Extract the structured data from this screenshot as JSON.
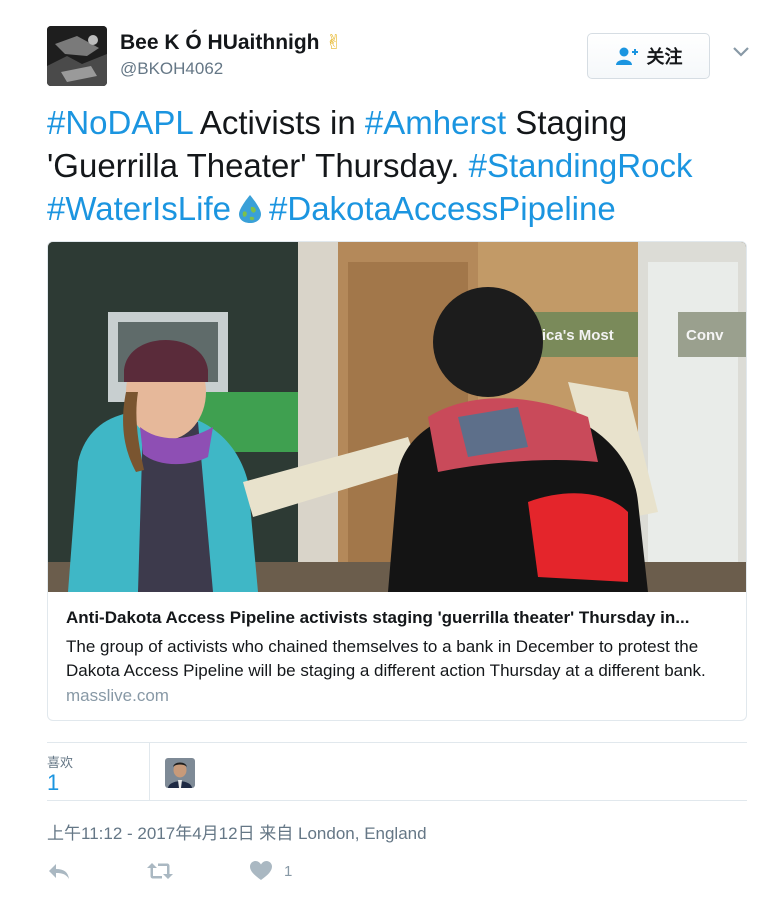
{
  "user": {
    "display_name": "Bee K Ó HUaithnigh",
    "emoji": "✌",
    "handle": "@BKOH4062"
  },
  "follow_label": "关注",
  "tweet": {
    "parts": [
      {
        "text": "#NoDAPL",
        "hashtag": true
      },
      {
        "text": " Activists in ",
        "hashtag": false
      },
      {
        "text": "#Amherst",
        "hashtag": true
      },
      {
        "text": " Staging 'Guerrilla Theater' Thursday. ",
        "hashtag": false
      },
      {
        "text": "#StandingRock",
        "hashtag": true
      },
      {
        "text": " ",
        "hashtag": false
      },
      {
        "text": "#WaterIsLife",
        "hashtag": true
      },
      {
        "text": "",
        "hashtag": false,
        "emoji": "earth-droplet"
      },
      {
        "text": "#DakotaAccessPipeline",
        "hashtag": true
      }
    ]
  },
  "card": {
    "title": "Anti-Dakota Access Pipeline activists staging 'guerrilla theater' Thursday in...",
    "description": "The group of activists who chained themselves to a bank in December to protest the Dakota Access Pipeline will be staging a different action Thursday at a different bank.",
    "domain": "masslive.com",
    "image_signs": [
      "rica's Most",
      "Conv"
    ]
  },
  "stats": {
    "likes_label": "喜欢",
    "likes_count": "1"
  },
  "timestamp": "上午11:12 - 2017年4月12日 来自 London, England",
  "actions": {
    "like_count": "1"
  },
  "colors": {
    "link": "#1b95e0",
    "muted": "#657786",
    "border": "#e1e8ed",
    "action_icon": "#aab8c2"
  }
}
